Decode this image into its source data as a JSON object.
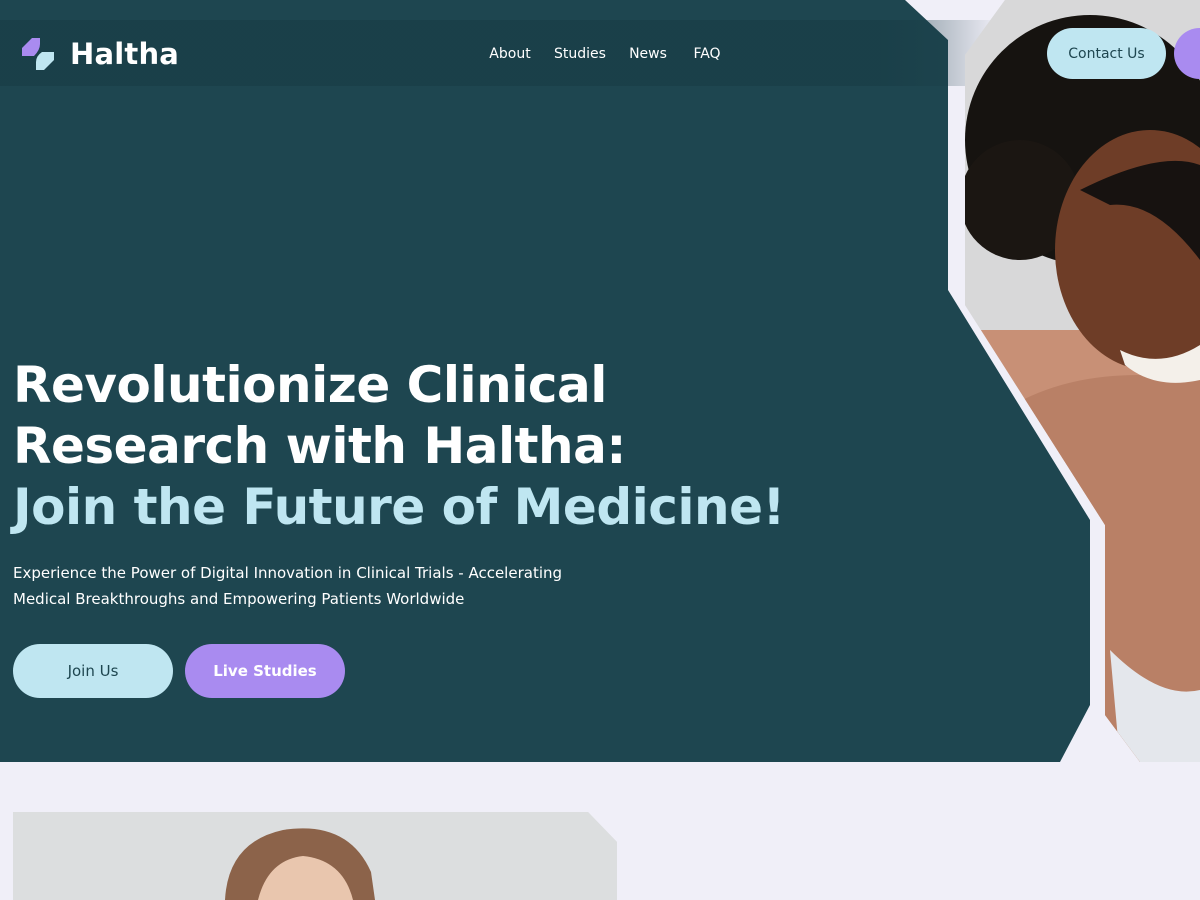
{
  "header": {
    "brand": "Haltha",
    "nav": [
      "About",
      "Studies",
      "News",
      "FAQ"
    ],
    "contact_label": "Contact Us"
  },
  "hero": {
    "headline_line1": "Revolutionize Clinical",
    "headline_line2": "Research with Haltha:",
    "headline_line3": "Join the Future of Medicine!",
    "subtext": "Experience the Power of Digital Innovation in Clinical Trials - Accelerating Medical Breakthroughs and Empowering Patients Worldwide",
    "join_label": "Join Us",
    "live_label": "Live Studies"
  },
  "colors": {
    "hero_bg": "#1e4650",
    "accent_light": "#bfe6f1",
    "accent_purple": "#a98bf0",
    "page_bg": "#f0eff8"
  }
}
